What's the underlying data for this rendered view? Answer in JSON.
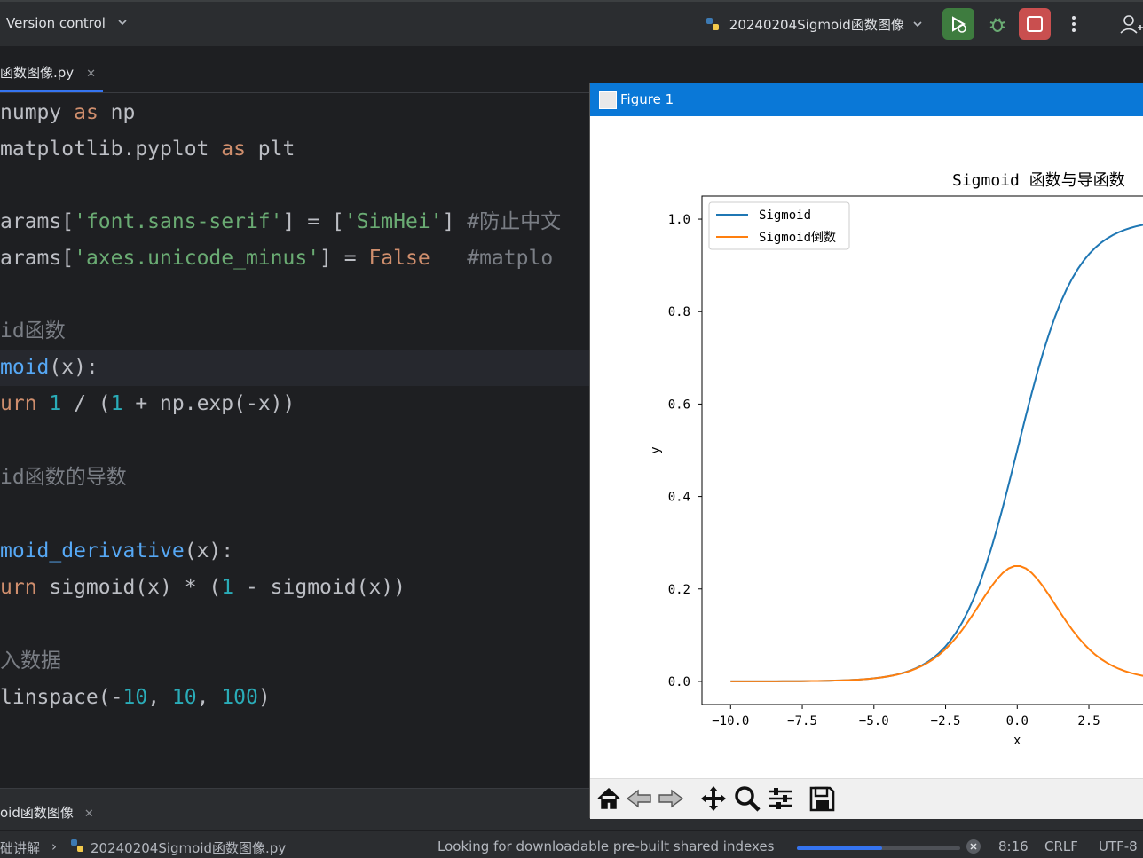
{
  "topbar": {
    "vcs_label": "Version control",
    "run_config": "20240204Sigmoid函数图像",
    "colors": {
      "run": "#3e7c3f",
      "stop": "#c94f4f"
    }
  },
  "editor": {
    "tab_label": "函数图像.py",
    "lines": [
      "numpy as np",
      "matplotlib.pyplot as plt",
      "",
      "arams['font.sans-serif'] = ['SimHei'] #防止中文",
      "arams['axes.unicode_minus'] = False   #matplo",
      "",
      "id函数",
      "moid(x):",
      "urn 1 / (1 + np.exp(-x))",
      "",
      "id函数的导数",
      "",
      "moid_derivative(x):",
      "urn sigmoid(x) * (1 - sigmoid(x))",
      "",
      "入数据",
      "linspace(-10, 10, 100)"
    ]
  },
  "bottom_tab": {
    "label": "oid函数图像"
  },
  "status": {
    "breadcrumb_root": "础讲解",
    "breadcrumb_file": "20240204Sigmoid函数图像.py",
    "indexing_text": "Looking for downloadable pre-built shared indexes",
    "indexing_progress": 0.52,
    "position": "8:16",
    "line_ending": "CRLF",
    "encoding": "UTF-8"
  },
  "figure": {
    "window_title": "Figure 1",
    "toolbar_icons": [
      "home-icon",
      "back-icon",
      "forward-icon",
      "pan-icon",
      "zoom-icon",
      "configure-icon",
      "save-icon"
    ]
  },
  "chart_data": {
    "type": "line",
    "title": "Sigmoid 函数与导函数",
    "xlabel": "x",
    "ylabel": "y",
    "xlim": [
      -11,
      5.1
    ],
    "ylim": [
      -0.05,
      1.05
    ],
    "xticks": [
      "−10.0",
      "−7.5",
      "−5.0",
      "−2.5",
      "0.0",
      "2.5"
    ],
    "yticks": [
      "0.0",
      "0.2",
      "0.4",
      "0.6",
      "0.8",
      "1.0"
    ],
    "legend_position": "top-left",
    "series": [
      {
        "name": "Sigmoid",
        "color": "#1f77b4",
        "function": "1/(1+exp(-x))",
        "x_range": [
          -10,
          10
        ]
      },
      {
        "name": "Sigmoid倒数",
        "color": "#ff7f0e",
        "function": "sigmoid(x)*(1-sigmoid(x))",
        "x_range": [
          -10,
          10
        ]
      }
    ]
  }
}
